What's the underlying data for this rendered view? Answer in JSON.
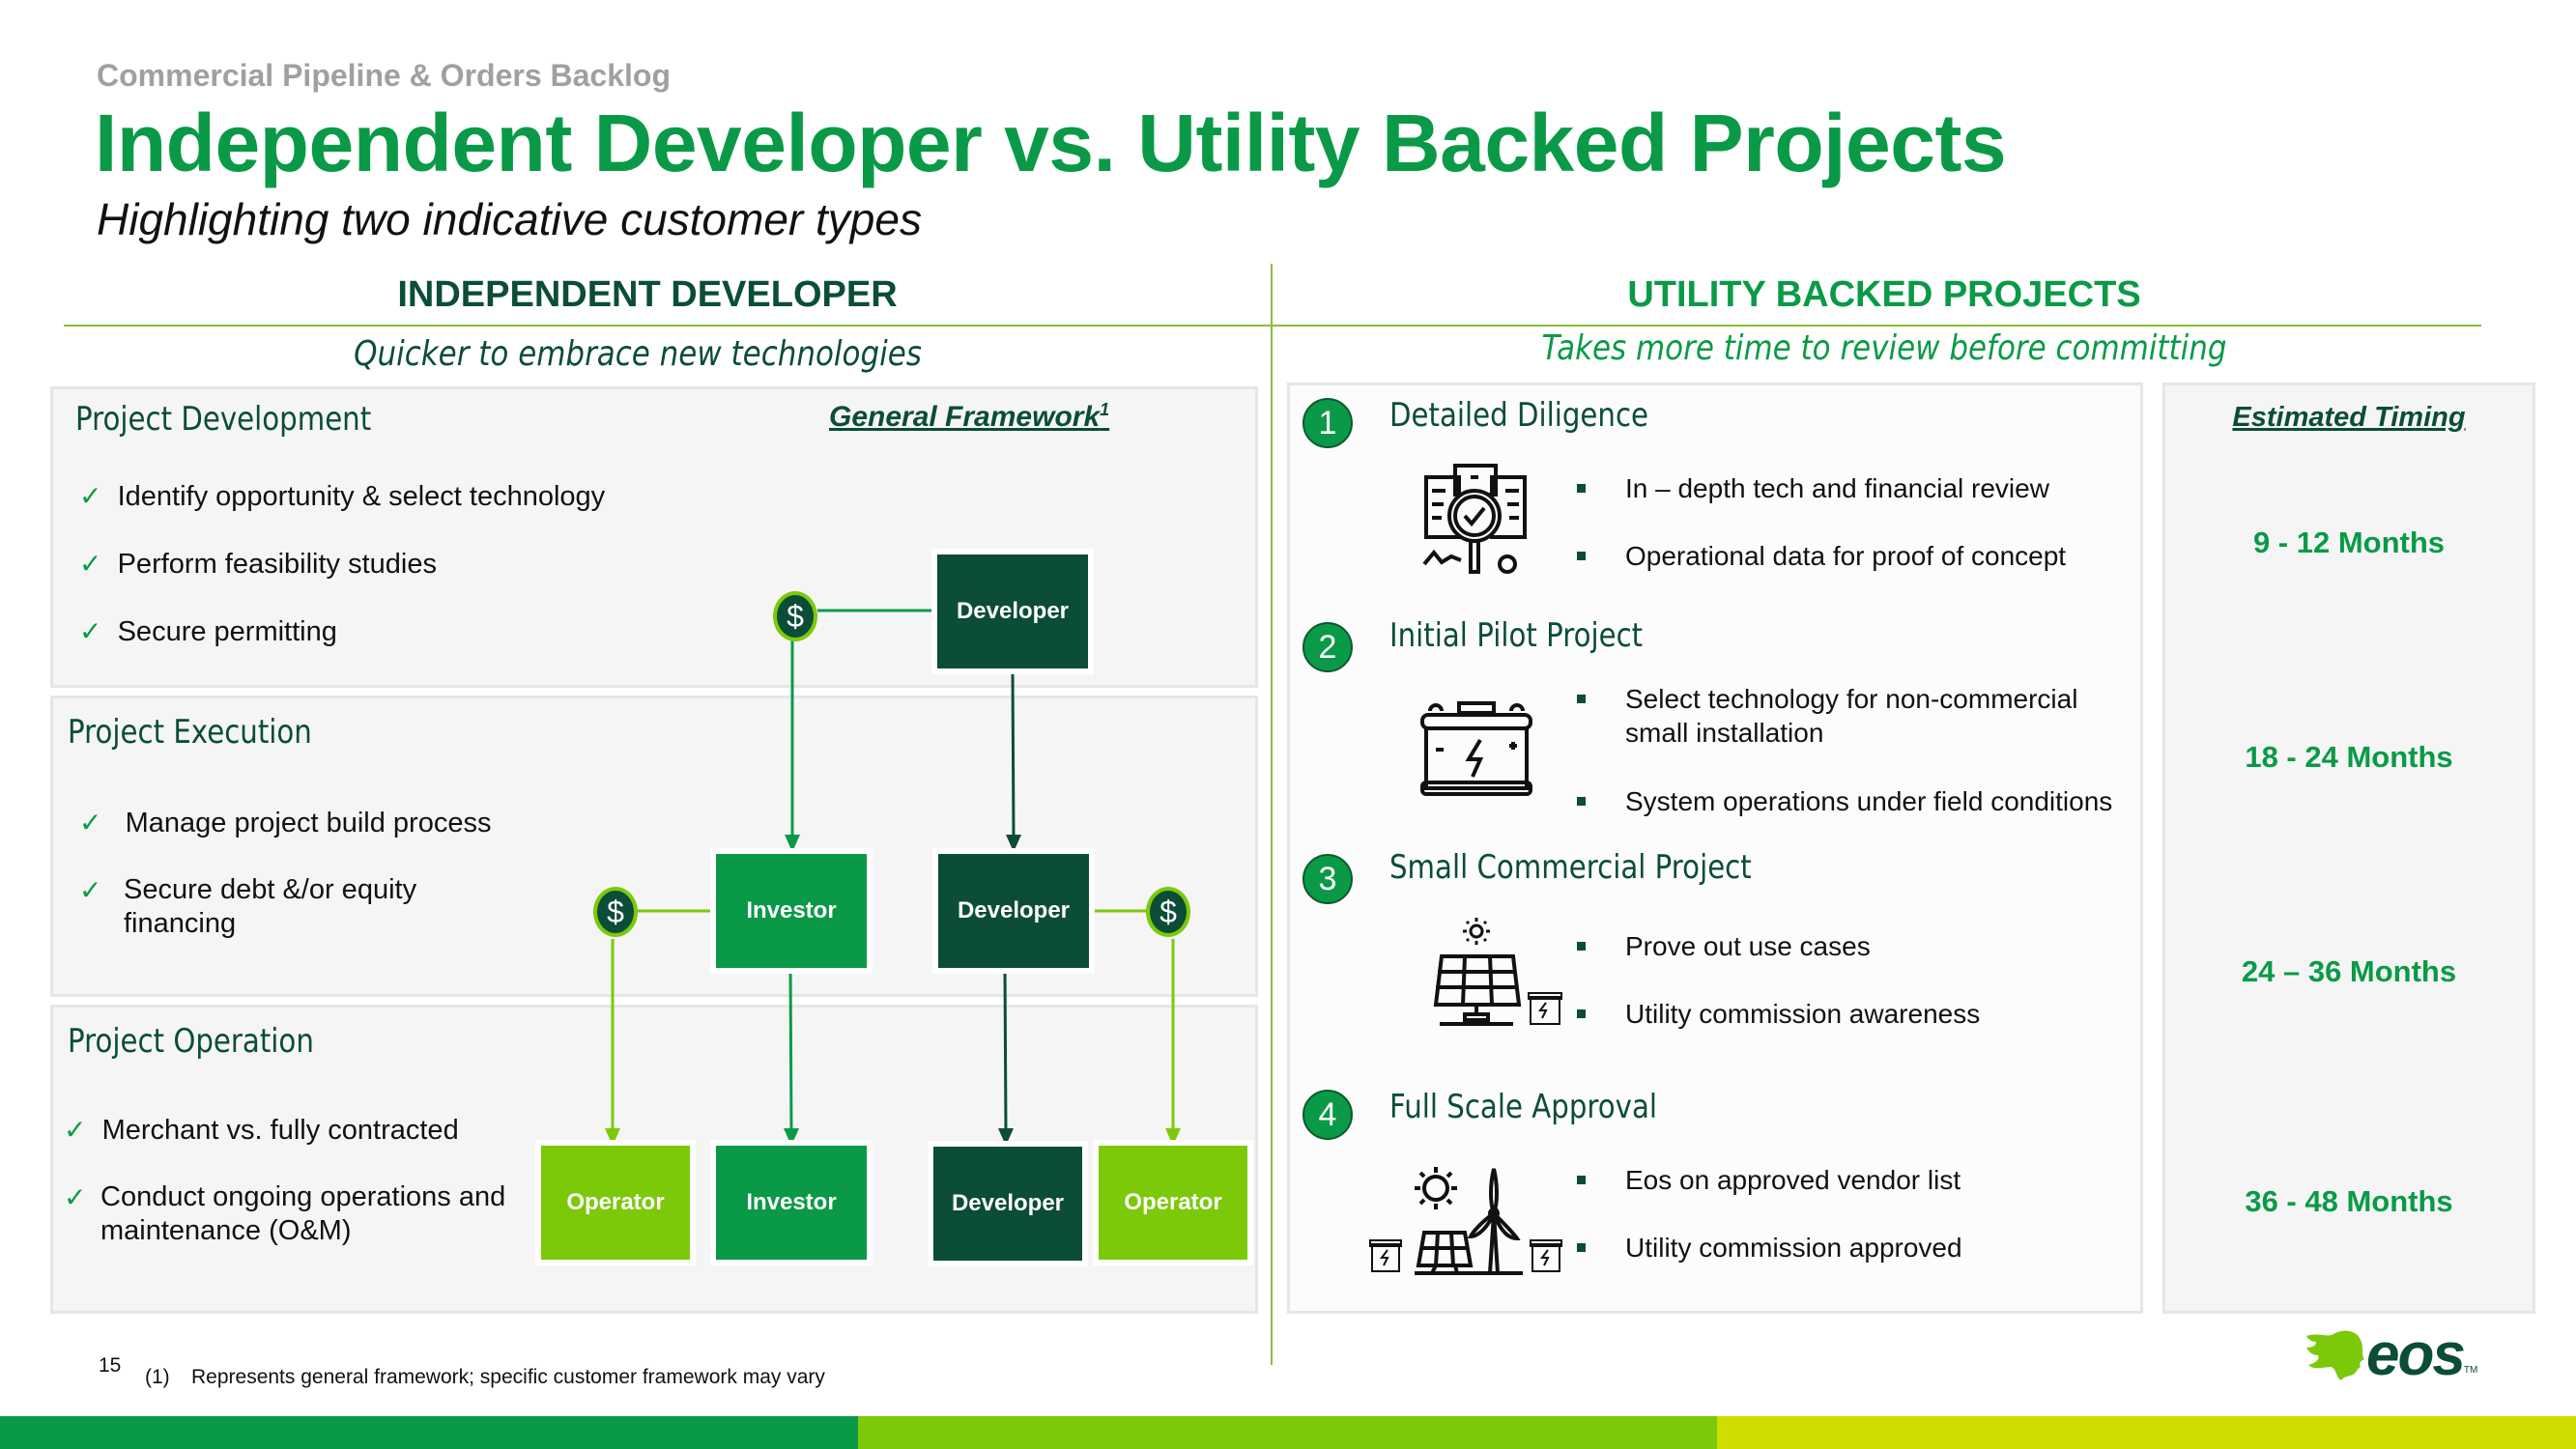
{
  "header": {
    "kicker": "Commercial Pipeline & Orders Backlog",
    "title": "Independent Developer vs. Utility Backed Projects",
    "subtitle": "Highlighting two indicative customer types"
  },
  "independent": {
    "heading": "INDEPENDENT DEVELOPER",
    "tagline": "Quicker to embrace new technologies",
    "framework_label": "General Framework",
    "framework_sup": "1",
    "sections": [
      {
        "title": "Project Development",
        "items": [
          "Identify opportunity & select technology",
          "Perform feasibility studies",
          "Secure permitting"
        ]
      },
      {
        "title": "Project Execution",
        "items": [
          "Manage project build process",
          "Secure debt &/or equity financing"
        ]
      },
      {
        "title": "Project Operation",
        "items": [
          "Merchant vs. fully contracted",
          "Conduct ongoing operations and maintenance (O&M)"
        ]
      }
    ],
    "check_icon": "✓",
    "diagram": {
      "dollar_symbol": "$",
      "development": {
        "developer": "Developer"
      },
      "execution": {
        "investor": "Investor",
        "developer": "Developer"
      },
      "operation": {
        "operator_left": "Operator",
        "investor": "Investor",
        "developer": "Developer",
        "operator_right": "Operator"
      }
    }
  },
  "utility": {
    "heading": "UTILITY BACKED PROJECTS",
    "tagline": "Takes more time to review  before committing",
    "steps": [
      {
        "number": "1",
        "title": "Detailed Diligence",
        "icon": "diligence-magnifier-icon",
        "bullets": [
          "In – depth tech and financial review",
          "Operational data for proof of concept"
        ]
      },
      {
        "number": "2",
        "title": "Initial Pilot Project",
        "icon": "battery-icon",
        "bullets": [
          "Select technology for non-commercial small installation",
          "System operations under field conditions"
        ]
      },
      {
        "number": "3",
        "title": "Small Commercial Project",
        "icon": "solar-panel-battery-icon",
        "bullets": [
          "Prove out use cases",
          "Utility commission awareness"
        ]
      },
      {
        "number": "4",
        "title": "Full Scale Approval",
        "icon": "solar-wind-battery-icon",
        "bullets": [
          "Eos on approved vendor list",
          "Utility commission approved"
        ]
      }
    ]
  },
  "timing": {
    "heading": "Estimated Timing",
    "values": [
      "9 - 12 Months",
      "18 - 24 Months",
      "24 – 36 Months",
      "36 - 48 Months"
    ]
  },
  "footer": {
    "page_number": "15",
    "footnote_number": "(1)",
    "footnote_text": "Represents general framework; specific customer framework may vary",
    "logo_text": "eos",
    "logo_tm": "TM"
  },
  "colors": {
    "brand_green": "#0a9a47",
    "dark_green": "#0b4d36",
    "lime": "#7cc90a",
    "yellow": "#d0dd00",
    "divider": "#8cbf3a"
  }
}
